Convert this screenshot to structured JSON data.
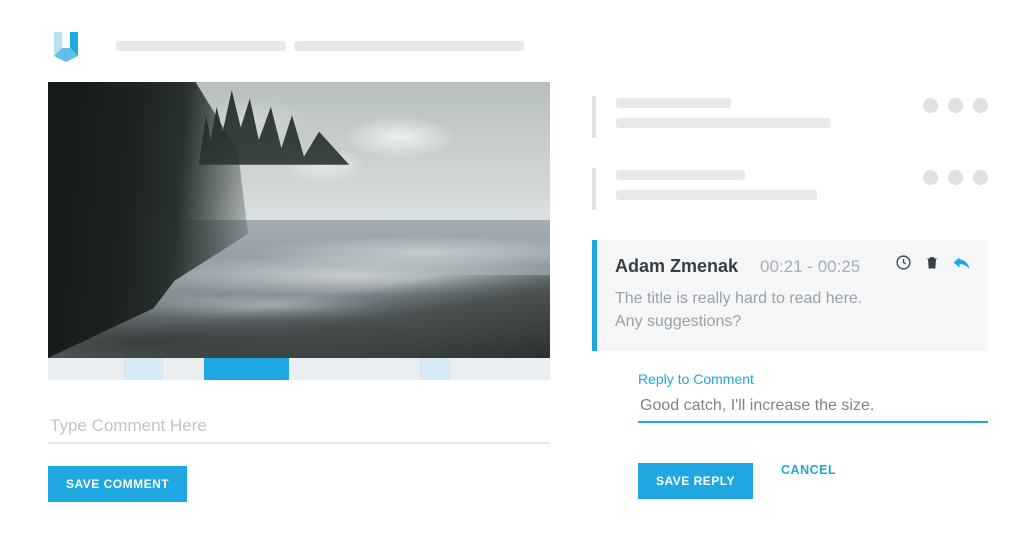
{
  "colors": {
    "accent": "#1ea7e1"
  },
  "comment_box": {
    "placeholder": "Type Comment Here",
    "save_label": "SAVE COMMENT"
  },
  "active_comment": {
    "author": "Adam Zmenak",
    "timestamp": "00:21 - 00:25",
    "body_line1": "The title is really hard to read here.",
    "body_line2": "Any suggestions?"
  },
  "reply": {
    "label": "Reply to Comment",
    "value": "Good catch, I'll increase the size.",
    "save_label": "SAVE REPLY",
    "cancel_label": "CANCEL"
  },
  "icons": {
    "clock": "clock-icon",
    "trash": "trash-icon",
    "reply": "reply-icon"
  }
}
